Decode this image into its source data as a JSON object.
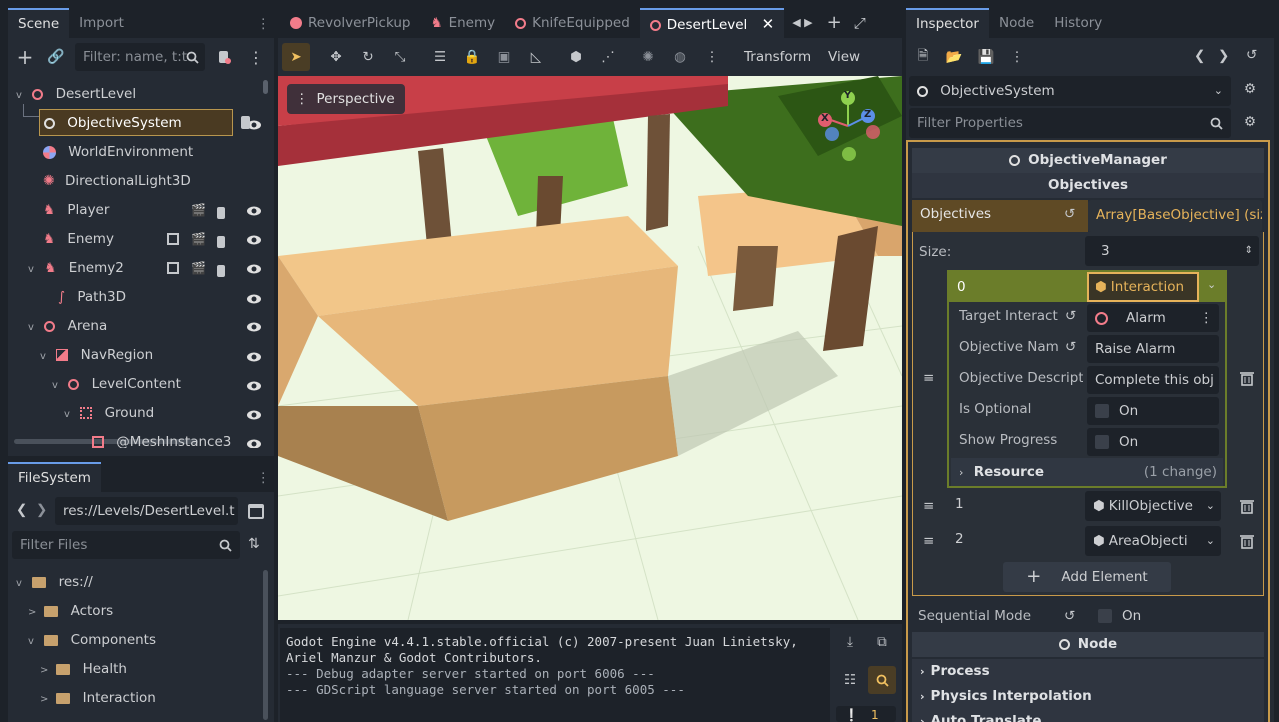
{
  "scene_panel": {
    "tabs": [
      "Scene",
      "Import"
    ],
    "filter_placeholder": "Filter: name, t:t",
    "tree": [
      {
        "label": "DesertLevel",
        "depth": 0,
        "arrow": "v"
      },
      {
        "label": "ObjectiveSystem",
        "depth": 1,
        "arrow": "",
        "selected": true
      },
      {
        "label": "WorldEnvironment",
        "depth": 1,
        "arrow": ""
      },
      {
        "label": "DirectionalLight3D",
        "depth": 1,
        "arrow": ""
      },
      {
        "label": "Player",
        "depth": 1,
        "arrow": ""
      },
      {
        "label": "Enemy",
        "depth": 1,
        "arrow": ""
      },
      {
        "label": "Enemy2",
        "depth": 1,
        "arrow": "v"
      },
      {
        "label": "Path3D",
        "depth": 2,
        "arrow": ""
      },
      {
        "label": "Arena",
        "depth": 1,
        "arrow": "v"
      },
      {
        "label": "NavRegion",
        "depth": 2,
        "arrow": "v"
      },
      {
        "label": "LevelContent",
        "depth": 3,
        "arrow": "v"
      },
      {
        "label": "Ground",
        "depth": 4,
        "arrow": "v"
      },
      {
        "label": "@MeshInstance3",
        "depth": 5,
        "arrow": ""
      }
    ]
  },
  "filesystem_panel": {
    "tab": "FileSystem",
    "path": "res://Levels/DesertLevel.t",
    "filter_placeholder": "Filter Files",
    "tree": [
      {
        "label": "res://",
        "depth": 0,
        "arrow": "v"
      },
      {
        "label": "Actors",
        "depth": 1,
        "arrow": ">"
      },
      {
        "label": "Components",
        "depth": 1,
        "arrow": "v"
      },
      {
        "label": "Health",
        "depth": 2,
        "arrow": ">"
      },
      {
        "label": "Interaction",
        "depth": 2,
        "arrow": ">"
      }
    ]
  },
  "editor_tabs": [
    {
      "label": "RevolverPickup",
      "active": false
    },
    {
      "label": "Enemy",
      "active": false
    },
    {
      "label": "KnifeEquipped",
      "active": false
    },
    {
      "label": "DesertLevel",
      "active": true
    }
  ],
  "toolbar": {
    "transform_label": "Transform",
    "view_label": "View"
  },
  "viewport": {
    "perspective_label": "Perspective",
    "gizmo": {
      "x": "X",
      "y": "Y",
      "z": "Z"
    }
  },
  "output": {
    "lines": [
      "Godot Engine v4.4.1.stable.official (c) 2007-present Juan Linietsky,",
      "Ariel Manzur & Godot Contributors.",
      "--- Debug adapter server started on port 6006 ---",
      "--- GDScript language server started on port 6005 ---"
    ],
    "badge": "1"
  },
  "inspector": {
    "tabs": [
      "Inspector",
      "Node",
      "History"
    ],
    "node_name": "ObjectiveSystem",
    "filter_placeholder": "Filter Properties",
    "script_header": "ObjectiveManager",
    "group_header": "Objectives",
    "objectives_label": "Objectives",
    "objectives_value": "Array[BaseObjective] (siz",
    "size_label": "Size:",
    "size_value": "3",
    "element0": {
      "index": "0",
      "type": "Interaction",
      "props": [
        {
          "label": "Target Interact",
          "value": "Alarm"
        },
        {
          "label": "Objective Nam",
          "value": "Raise Alarm"
        },
        {
          "label": "Objective Descripti",
          "value": "Complete this obj"
        },
        {
          "label": "Is Optional",
          "value": "On"
        },
        {
          "label": "Show Progress",
          "value": "On"
        }
      ],
      "resource_label": "Resource",
      "resource_changes": "(1 change)"
    },
    "element1": {
      "index": "1",
      "type": "KillObjective"
    },
    "element2": {
      "index": "2",
      "type": "AreaObjecti"
    },
    "add_element": "Add Element",
    "sequential_label": "Sequential Mode",
    "sequential_value": "On",
    "node_header": "Node",
    "groups": [
      "Process",
      "Physics Interpolation",
      "Auto Translate"
    ]
  },
  "colors": {
    "accent": "#699ce8",
    "highlight": "#e6b35a",
    "element_green": "#6b7d2a"
  }
}
